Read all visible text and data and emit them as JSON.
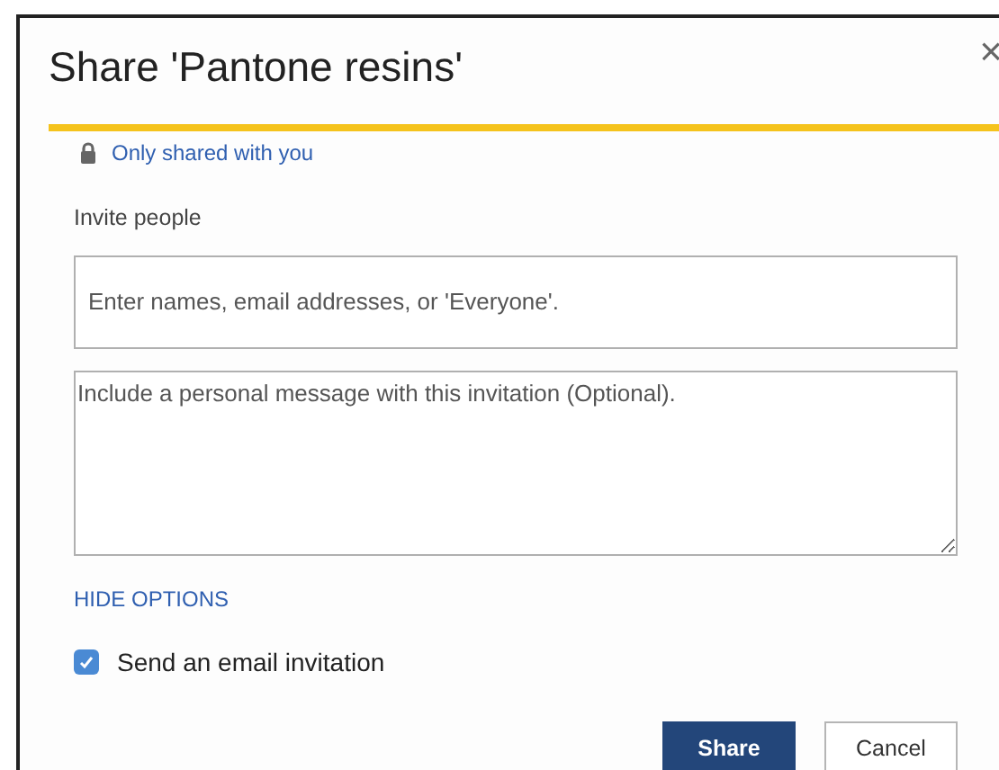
{
  "dialog": {
    "title": "Share 'Pantone resins'",
    "close": "×"
  },
  "sharing_status": "Only shared with you",
  "invite_label": "Invite people",
  "people_field": {
    "placeholder": "Enter names, email addresses, or 'Everyone'."
  },
  "message_field": {
    "placeholder": "Include a personal message with this invitation (Optional)."
  },
  "options_toggle": "HIDE OPTIONS",
  "email_invitation": {
    "label": "Send an email invitation",
    "checked": true
  },
  "buttons": [
    {
      "label": "Share",
      "kind": "primary"
    },
    {
      "label": "Cancel",
      "kind": "secondary"
    }
  ]
}
